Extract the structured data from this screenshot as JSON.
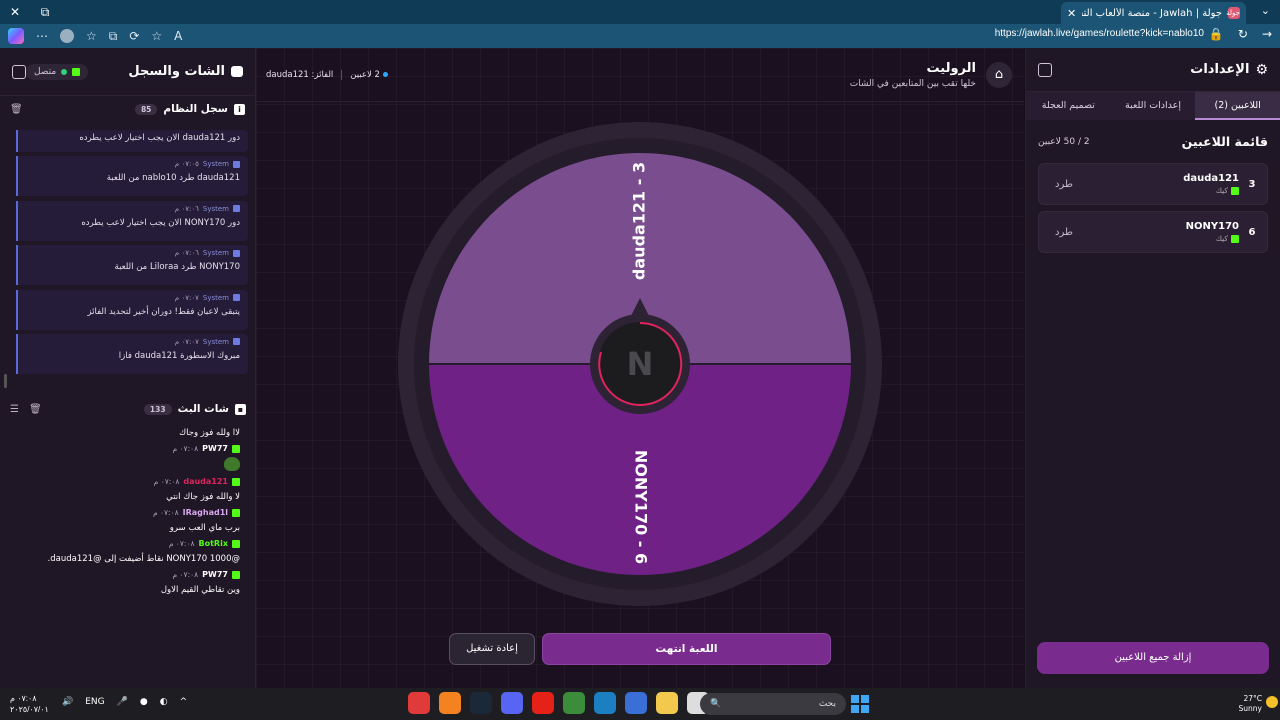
{
  "browser": {
    "tab_title": "جولة | Jawlah - منصة الألعاب التفا...",
    "tab_icon": "جولة",
    "url": "https://jawlah.live/games/roulette?kick=nablo10",
    "new_tab": "+",
    "close": "✕"
  },
  "settings": {
    "title": "الإعدادات",
    "tabs": [
      "اللاعبين (2)",
      "إعدادات اللعبة",
      "تصميم العجلة"
    ],
    "players_title": "قائمة اللاعبين",
    "players_count": "2 / 50 لاعبين",
    "players": [
      {
        "num": "3",
        "name": "dauda121",
        "platform": "كيك",
        "kick": "طرد"
      },
      {
        "num": "6",
        "name": "NONY170",
        "platform": "كيك",
        "kick": "طرد"
      }
    ],
    "remove_all": "إزالة جميع اللاعبين"
  },
  "game": {
    "title": "الروليت",
    "subtitle": "خلها تقب بين المتابعين في الشات",
    "players_status": "2 لاعبين",
    "winner": "الفائز: dauda121",
    "wheel": [
      {
        "label": "dauda121 - 3",
        "color": "#7a4d8e"
      },
      {
        "label": "NONY170 - 6",
        "color": "#6f2186"
      }
    ],
    "end_button": "اللعبة انتهت",
    "replay_button": "إعادة تشغيل",
    "center_logo": "N"
  },
  "chat": {
    "title": "الشات والسجل",
    "online": "متصل",
    "system_log": {
      "title": "سجل النظام",
      "count": "85",
      "first_text": "دور dauda121 الان يجب اختيار لاعب يطرده",
      "items": [
        {
          "user": "System",
          "time": "٠٧:٠٥ م",
          "text": "dauda121 طرد nablo10 من اللعبة"
        },
        {
          "user": "System",
          "time": "٠٧:٠٦ م",
          "text": "دور NONY170 الان يجب اختيار لاعب يطرده"
        },
        {
          "user": "System",
          "time": "٠٧:٠٦ م",
          "text": "NONY170 طرد Liloraa من اللعبة"
        },
        {
          "user": "System",
          "time": "٠٧:٠٧ م",
          "text": "يتبقى لاعبان فقط! دوران أخير لتحديد الفائز"
        },
        {
          "user": "System",
          "time": "٠٧:٠٧ م",
          "text": "مبروك الاسطورة dauda121 فازا"
        }
      ]
    },
    "live_chat": {
      "title": "شات البث",
      "count": "133",
      "first_text": "لاا ولله فوز وجاك",
      "messages": [
        {
          "user": "PW77",
          "time": "٠٧:٠٨ م",
          "text": "",
          "color": "#ffffff",
          "emote": true
        },
        {
          "user": "dauda121",
          "time": "٠٧:٠٨ م",
          "text": "لا والله فوز جاك انتي",
          "color": "#e0245e",
          "emote": false
        },
        {
          "user": "IRaghad1l",
          "time": "٠٧:٠٨ م",
          "text": "برب ماي العب سرو",
          "color": "#d8a8f0",
          "emote": false
        },
        {
          "user": "BotRix",
          "time": "٠٧:٠٨ م",
          "text": "@NONY170 1000 نقاط أضيفت إلى @dauda121.",
          "color": "#53fc18",
          "emote": false
        },
        {
          "user": "PW77",
          "time": "٠٧:٠٨ م",
          "text": "وين تقاطي القيم الاول",
          "color": "#ffffff",
          "emote": false
        }
      ]
    }
  },
  "taskbar": {
    "time": "٠٧:٠٨ م",
    "date": "٢٠٢٥/٠٧/٠١",
    "lang": "ENG",
    "search": "بحث",
    "temp": "27°C",
    "weather": "Sunny"
  }
}
